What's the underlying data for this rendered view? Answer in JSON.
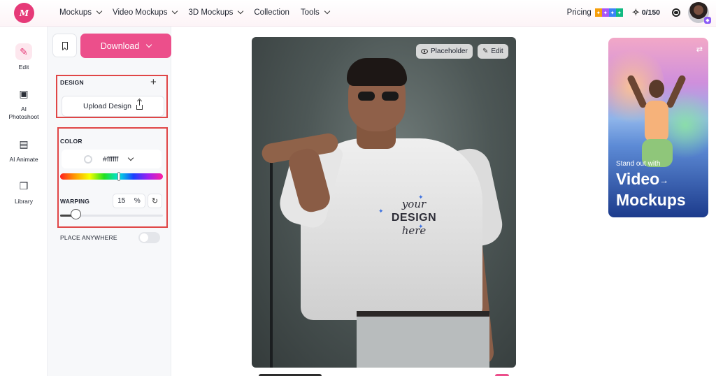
{
  "brand": {
    "logo_text": "M"
  },
  "nav": {
    "items": [
      "Mockups",
      "Video Mockups",
      "3D Mockups",
      "Collection",
      "Tools"
    ],
    "pricing": "Pricing",
    "credits": "0/150"
  },
  "rail": {
    "items": [
      {
        "label": "Edit"
      },
      {
        "label": "AI Photoshoot"
      },
      {
        "label": "AI Animate"
      },
      {
        "label": "Library"
      }
    ]
  },
  "panel": {
    "download_label": "Download",
    "design_label": "DESIGN",
    "upload_label": "Upload Design",
    "color_label": "COLOR",
    "color_value": "#ffffff",
    "warping_label": "WARPING",
    "warping_value": "15",
    "warping_unit": "%",
    "warping_level": 0.15,
    "place_anywhere_label": "PLACE ANYWHERE",
    "place_anywhere_on": false
  },
  "canvas": {
    "placeholder_label": "Placeholder",
    "edit_label": "Edit",
    "shirt_text": [
      "your",
      "DESIGN",
      "here"
    ]
  },
  "promo": {
    "subtitle": "Stand out with",
    "title_line1": "Video",
    "title_line2": "Mockups"
  },
  "colors": {
    "accent": "#ec4f8b",
    "highlight_box": "#e04646"
  }
}
